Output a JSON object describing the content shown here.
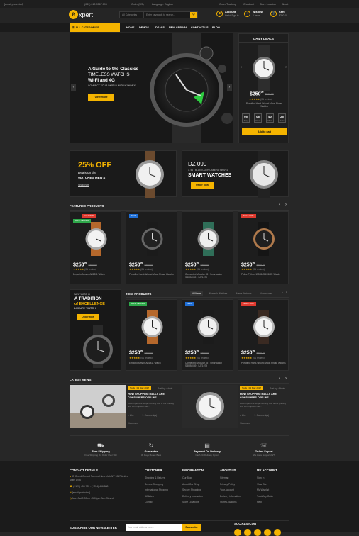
{
  "topbar": {
    "email": "[email protected]",
    "phone": "(089) 012-9567 893",
    "order": "Order (US)",
    "lang": "Language: English",
    "tracking": "Order Tracking",
    "checkout": "Checkout",
    "store": "Store Location",
    "about": "About"
  },
  "header": {
    "logo_letter": "e",
    "logo_text": "xpert",
    "search_category": "All Categories",
    "search_placeholder": "Enter keywords to search...",
    "account_title": "Account",
    "account_sub": "Hello! Sign in",
    "wishlist_title": "Wishlist",
    "wishlist_sub": "0 items",
    "cart_title": "Cart:",
    "cart_sub": "$250.00"
  },
  "nav": {
    "all_categories": "ALL CATEGORIES",
    "items": [
      "HOME",
      "DEMOS",
      "DEALS",
      "NEW ARRIVAL",
      "CONTACT US",
      "BLOG"
    ]
  },
  "hero": {
    "title": "A Guide to the Classics",
    "line2": "TIMELESS WATCHS",
    "line3": "WI-FI and 4G",
    "line4": "CONNECT YOUR WORLD WITH ICONNEX",
    "button": "View more"
  },
  "daily": {
    "title": "DAILY DEALS",
    "price": "$250",
    "cents": "00",
    "old": "$500.00",
    "rating": "(01 review)",
    "name": "Portofino Hand-Wound Moon Phase Watchs",
    "timer": [
      {
        "v": "05",
        "l": "Day"
      },
      {
        "v": "06",
        "l": "Hours"
      },
      {
        "v": "40",
        "l": "Mins"
      },
      {
        "v": "25",
        "l": "Secs"
      }
    ],
    "cart": "Add to cart"
  },
  "banner1": {
    "big": "25% OFF",
    "l1": "Deals on the",
    "l2": "WATCHES MEN'S",
    "link": "Shop now"
  },
  "banner2": {
    "model": "DZ 090",
    "sub": "1. 56 \" BLUETOOTH CAMERA SWIVEL",
    "title": "SMART WATCHES",
    "button": "Order now"
  },
  "featured": {
    "title": "FEATURED PRODUCTS",
    "products": [
      {
        "price": "$250",
        "cents": "99",
        "old": "$500.00",
        "rating": "(01 review)",
        "name": "Emporio Armani AR1811 Watch",
        "tags": [
          "SALE 50%",
          "BESTSELLER"
        ]
      },
      {
        "price": "$250",
        "cents": "99",
        "old": "$500.00",
        "rating": "(01 review)",
        "name": "Portofino Hand-Wound Moon Phase Watchs",
        "tags": [
          "NEW"
        ]
      },
      {
        "price": "$250",
        "cents": "99",
        "old": "$500.00",
        "rating": "(01 review)",
        "name": "Connected Modular 45 - Smartwatch SBFB0049 - SJT1079",
        "tags": []
      },
      {
        "price": "$250",
        "cents": "99",
        "old": "$500.00",
        "rating": "(01 review)",
        "name": "Police Python 15505JSB/01MR Watch",
        "tags": [
          "SALE 50%"
        ]
      }
    ]
  },
  "promo": {
    "small": "NEW WATCHS",
    "l1": "A TRADITION",
    "l2": "of EXCELLENCE",
    "l3": "LUXURY WATCH",
    "button": "Order now"
  },
  "newp": {
    "title": "NEW PRODUCTS",
    "tabs": [
      "All Items",
      "Women's Watches",
      "Men's Watches",
      "Accessories"
    ],
    "products": [
      {
        "price": "$250",
        "cents": "99",
        "old": "$500.00",
        "rating": "(01 review)",
        "name": "Emporio Armani AR1811 Watch",
        "tags": [
          "BESTSELLER"
        ]
      },
      {
        "price": "$250",
        "cents": "99",
        "old": "$500.00",
        "rating": "(01 review)",
        "name": "Connected Modular 45 - Smartwatch SBFB0049 - SJT1079",
        "tags": [
          "NEW"
        ]
      },
      {
        "price": "$250",
        "cents": "99",
        "old": "$500.00",
        "rating": "(01 review)",
        "name": "Portofino Hand-Wound Moon Phase Watchs",
        "tags": [
          "SALE 50%"
        ]
      }
    ]
  },
  "news": {
    "title": "LATEST NEWS",
    "posts": [
      {
        "date": "Tools - 04 May 2017",
        "by": "Post by: Admin",
        "title": "HOW SHOPPING MALLS ARE CONSUMERS OFFLINE",
        "text": "Lorem ipsum is simply dummy text of the printing and comm ipsum has...",
        "likes": "Like",
        "comments": "Comment(s)",
        "more": "View more"
      },
      {
        "date": "Tools - 04 May 2017",
        "by": "Post by: Admin",
        "title": "HOW SHOPPING MALLS ARE CONSUMERS OFFLINE",
        "text": "Lorem ipsum is simply dummy text of the printing and comm ipsum has...",
        "likes": "Like",
        "comments": "Comment(s)",
        "more": "View more"
      }
    ]
  },
  "features": [
    {
      "t": "Free Shipping",
      "s": "Free Shipping On Order Over $99"
    },
    {
      "t": "Guarantee",
      "s": "30 Days Money Back"
    },
    {
      "t": "Payment On Delivery",
      "s": "Cash On Delivery Option"
    },
    {
      "t": "Online Suport",
      "s": "We Have Support 24/7"
    }
  ],
  "footer": {
    "contact": {
      "title": "CONTACT DETAILS",
      "address": "45 Grand Central Terminal New York,NY 1017 United State USA",
      "phone": "(+123) 456 789 - (+254) 456 888",
      "email": "[email protected]",
      "hours": "Mon-Sat 9:00pm - 5:00pm Sun:Closed"
    },
    "customer": {
      "title": "CUSTOMER",
      "items": [
        "Shipping & Returns",
        "Secure Shopping",
        "International Shipping",
        "Affiliates",
        "Contact"
      ]
    },
    "information": {
      "title": "INFORMATION",
      "items": [
        "Our Blog",
        "About Our Shop",
        "Secure Shopping",
        "Delivery infomation",
        "Store Locations"
      ]
    },
    "about": {
      "title": "ABOUT US",
      "items": [
        "Sitemap",
        "Privacy Policy",
        "Your Account",
        "Delivery infomation",
        "Store Locations"
      ]
    },
    "account": {
      "title": "MY ACCOUNT",
      "items": [
        "Sign in",
        "View Cart",
        "My Wishlist",
        "Track My Order",
        "Help"
      ]
    },
    "newsletter": {
      "title": "SUBSCRIBE OUR NEWSLETTER",
      "placeholder": "Your email address here...",
      "button": "Subscribe"
    },
    "social": "SOCIALS ICON"
  }
}
